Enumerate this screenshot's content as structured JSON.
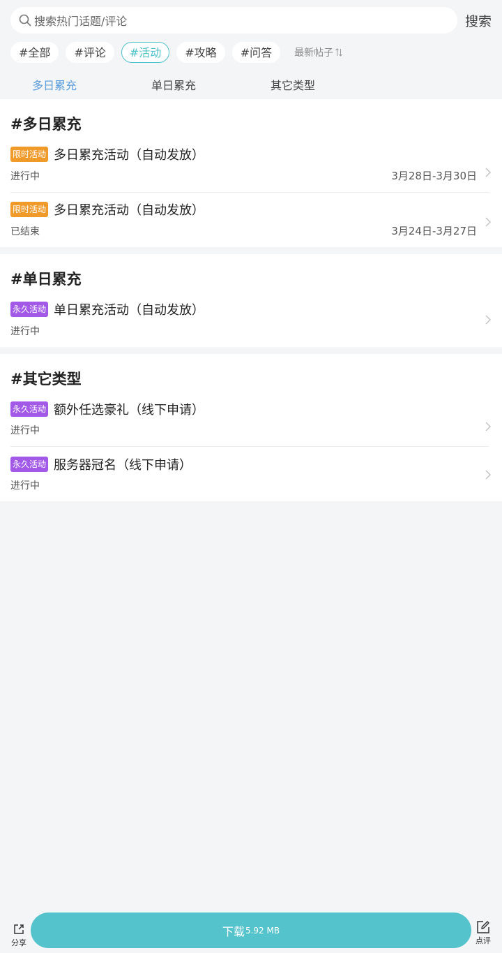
{
  "search": {
    "placeholder": "搜索热门话题/评论",
    "button_label": "搜索"
  },
  "chips": [
    {
      "label": "#全部",
      "active": false
    },
    {
      "label": "#评论",
      "active": false
    },
    {
      "label": "#活动",
      "active": true
    },
    {
      "label": "#攻略",
      "active": false
    },
    {
      "label": "#问答",
      "active": false
    }
  ],
  "sort_label": "最新帖子",
  "tabs": [
    {
      "label": "多日累充",
      "active": true
    },
    {
      "label": "单日累充",
      "active": false
    },
    {
      "label": "其它类型",
      "active": false
    }
  ],
  "sections": [
    {
      "title": "#多日累充",
      "items": [
        {
          "badge": "限时活动",
          "title": "多日累充活动（自动发放）",
          "status": "进行中",
          "date": "3月28日-3月30日"
        },
        {
          "badge": "限时活动",
          "title": "多日累充活动（自动发放）",
          "status": "已结束",
          "date": "3月24日-3月27日"
        }
      ]
    },
    {
      "title": "#单日累充",
      "items": [
        {
          "badge": "永久活动",
          "title": "单日累充活动（自动发放）",
          "status": "进行中"
        }
      ]
    },
    {
      "title": "#其它类型",
      "items": [
        {
          "badge": "永久活动",
          "title": "额外任选豪礼（线下申请）",
          "status": "进行中"
        },
        {
          "badge": "永久活动",
          "title": "服务器冠名（线下申请）",
          "status": "进行中"
        }
      ]
    }
  ],
  "bottom": {
    "share_label": "分享",
    "download_label": "下载",
    "download_size": "5.92 MB",
    "review_label": "点评"
  },
  "colors": {
    "accent": "#4fc1c9",
    "tab_active": "#5b9edb",
    "badge_limited": "#f09a2a",
    "badge_forever": "#a259e8",
    "download_button": "#54c3cc"
  }
}
